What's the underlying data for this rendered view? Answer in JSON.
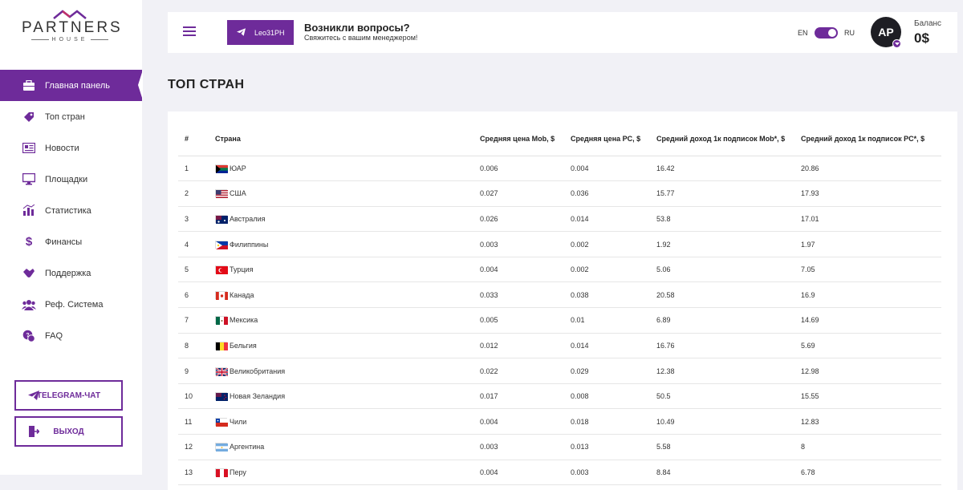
{
  "brand": {
    "name": "PARTNERS",
    "sub": "HOUSE"
  },
  "nav": [
    {
      "label": "Главная панель",
      "icon": "briefcase-icon",
      "active": true
    },
    {
      "label": "Топ стран",
      "icon": "tag-icon",
      "active": false
    },
    {
      "label": "Новости",
      "icon": "newspaper-icon",
      "active": false
    },
    {
      "label": "Площадки",
      "icon": "monitor-icon",
      "active": false
    },
    {
      "label": "Статистика",
      "icon": "chart-icon",
      "active": false
    },
    {
      "label": "Финансы",
      "icon": "dollar-icon",
      "active": false
    },
    {
      "label": "Поддержка",
      "icon": "handshake-icon",
      "active": false
    },
    {
      "label": "Реф. Система",
      "icon": "users-icon",
      "active": false
    },
    {
      "label": "FAQ",
      "icon": "faq-icon",
      "active": false
    }
  ],
  "buttons": {
    "telegram": "TELEGRAM-ЧАТ",
    "logout": "ВЫХОД"
  },
  "header": {
    "user_tag": "Leo31PH",
    "question_title": "Возникли вопросы?",
    "question_sub": "Свяжитесь с вашим менеджером!",
    "lang_en": "EN",
    "lang_ru": "RU",
    "avatar_initials": "AP",
    "balance_label": "Баланс",
    "balance_value": "0$"
  },
  "page_title": "ТОП СТРАН",
  "table": {
    "headers": [
      "#",
      "Страна",
      "Средняя цена Mob, $",
      "Средняя цена PC, $",
      "Средний доход 1к подписок Mob*, $",
      "Средний доход 1к подписок PC*, $"
    ],
    "rows": [
      {
        "n": "1",
        "country": "ЮАР",
        "flag": "za",
        "mob": "0.006",
        "pc": "0.004",
        "inc_mob": "16.42",
        "inc_pc": "20.86"
      },
      {
        "n": "2",
        "country": "США",
        "flag": "us",
        "mob": "0.027",
        "pc": "0.036",
        "inc_mob": "15.77",
        "inc_pc": "17.93"
      },
      {
        "n": "3",
        "country": "Австралия",
        "flag": "au",
        "mob": "0.026",
        "pc": "0.014",
        "inc_mob": "53.8",
        "inc_pc": "17.01"
      },
      {
        "n": "4",
        "country": "Филиппины",
        "flag": "ph",
        "mob": "0.003",
        "pc": "0.002",
        "inc_mob": "1.92",
        "inc_pc": "1.97"
      },
      {
        "n": "5",
        "country": "Турция",
        "flag": "tr",
        "mob": "0.004",
        "pc": "0.002",
        "inc_mob": "5.06",
        "inc_pc": "7.05"
      },
      {
        "n": "6",
        "country": "Канада",
        "flag": "ca",
        "mob": "0.033",
        "pc": "0.038",
        "inc_mob": "20.58",
        "inc_pc": "16.9"
      },
      {
        "n": "7",
        "country": "Мексика",
        "flag": "mx",
        "mob": "0.005",
        "pc": "0.01",
        "inc_mob": "6.89",
        "inc_pc": "14.69"
      },
      {
        "n": "8",
        "country": "Бельгия",
        "flag": "be",
        "mob": "0.012",
        "pc": "0.014",
        "inc_mob": "16.76",
        "inc_pc": "5.69"
      },
      {
        "n": "9",
        "country": "Великобритания",
        "flag": "gb",
        "mob": "0.022",
        "pc": "0.029",
        "inc_mob": "12.38",
        "inc_pc": "12.98"
      },
      {
        "n": "10",
        "country": "Новая Зеландия",
        "flag": "nz",
        "mob": "0.017",
        "pc": "0.008",
        "inc_mob": "50.5",
        "inc_pc": "15.55"
      },
      {
        "n": "11",
        "country": "Чили",
        "flag": "cl",
        "mob": "0.004",
        "pc": "0.018",
        "inc_mob": "10.49",
        "inc_pc": "12.83"
      },
      {
        "n": "12",
        "country": "Аргентина",
        "flag": "ar",
        "mob": "0.003",
        "pc": "0.013",
        "inc_mob": "5.58",
        "inc_pc": "8"
      },
      {
        "n": "13",
        "country": "Перу",
        "flag": "pe",
        "mob": "0.004",
        "pc": "0.003",
        "inc_mob": "8.84",
        "inc_pc": "6.78"
      }
    ]
  },
  "colors": {
    "accent": "#6e2b9a",
    "background": "#f1f1f6",
    "avatar": "#1e1e24"
  }
}
